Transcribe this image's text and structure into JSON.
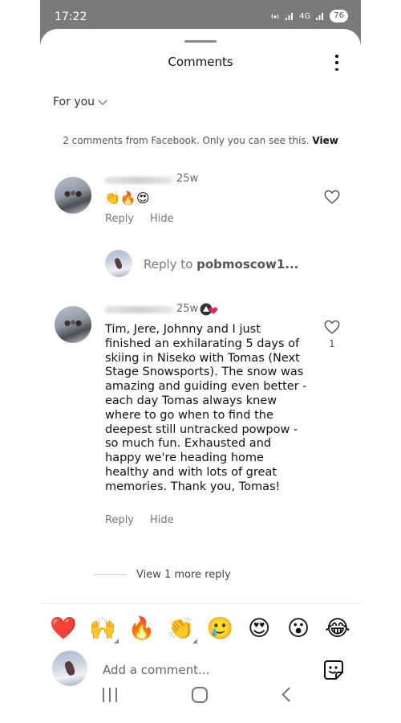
{
  "status_bar": {
    "time": "17:22",
    "network": "4G",
    "battery": "76"
  },
  "header": {
    "title": "Comments",
    "more_icon": "kebab-menu-icon"
  },
  "sort": {
    "label": "For you"
  },
  "facebook_notice": {
    "text": "2 comments from Facebook. Only you can see this.",
    "link": "View"
  },
  "comments": [
    {
      "age": "25w",
      "text": "👏🔥😍",
      "reply_label": "Reply",
      "hide_label": "Hide",
      "liked_count": ""
    },
    {
      "age": "25w",
      "badge_icon": "facebook-heart-badge-icon",
      "text": "Tim, Jere, Johnny and I just finished an exhilarating 5 days of skiing in Niseko with Tomas (Next Stage Snowsports). The snow was amazing and guiding even better - each day Tomas always knew where to go when to find the deepest still untracked powpow - so much fun. Exhausted and happy we're heading home healthy and with lots of great memories. Thank you, Tomas!",
      "reply_label": "Reply",
      "hide_label": "Hide",
      "like_count": "1"
    }
  ],
  "reply_input": {
    "prefix": "Reply to ",
    "username": "pobmoscow1..."
  },
  "view_more_replies": "View 1 more reply",
  "reactions": [
    "❤️",
    "🙌",
    "🔥",
    "👏",
    "🥲",
    "😍",
    "😮",
    "😂"
  ],
  "reaction_skin_tone": [
    false,
    true,
    false,
    true,
    false,
    false,
    false,
    false
  ],
  "add_comment": {
    "placeholder": "Add a comment..."
  }
}
